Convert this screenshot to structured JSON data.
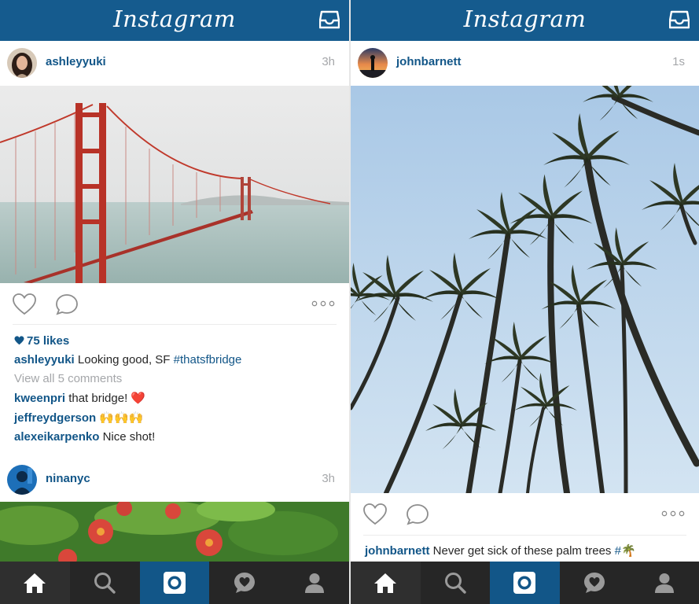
{
  "app_title": "Instagram",
  "left": {
    "post1": {
      "username": "ashleyyuki",
      "time": "3h",
      "likes": "75 likes",
      "caption_user": "ashleyyuki",
      "caption_text": " Looking good, SF ",
      "caption_tag": "#thatsfbridge",
      "view_comments": "View all 5 comments",
      "comments": [
        {
          "user": "kweenpri",
          "text": " that bridge! ❤️"
        },
        {
          "user": "jeffreydgerson",
          "text": " 🙌🙌🙌"
        },
        {
          "user": "alexeikarpenko",
          "text": " Nice shot!"
        }
      ]
    },
    "post2": {
      "username": "ninanyc",
      "time": "3h"
    }
  },
  "right": {
    "post1": {
      "username": "johnbarnett",
      "time": "1s",
      "caption_user": "johnbarnett",
      "caption_text": " Never get sick of these palm trees ",
      "caption_tag": "#🌴"
    }
  },
  "tabs": [
    "home-icon",
    "search-icon",
    "camera-icon",
    "activity-icon",
    "profile-icon"
  ],
  "colors": {
    "brand_blue": "#155b8e",
    "link_blue": "#125688",
    "tab_bar": "#262626",
    "muted": "#a5a7aa"
  }
}
